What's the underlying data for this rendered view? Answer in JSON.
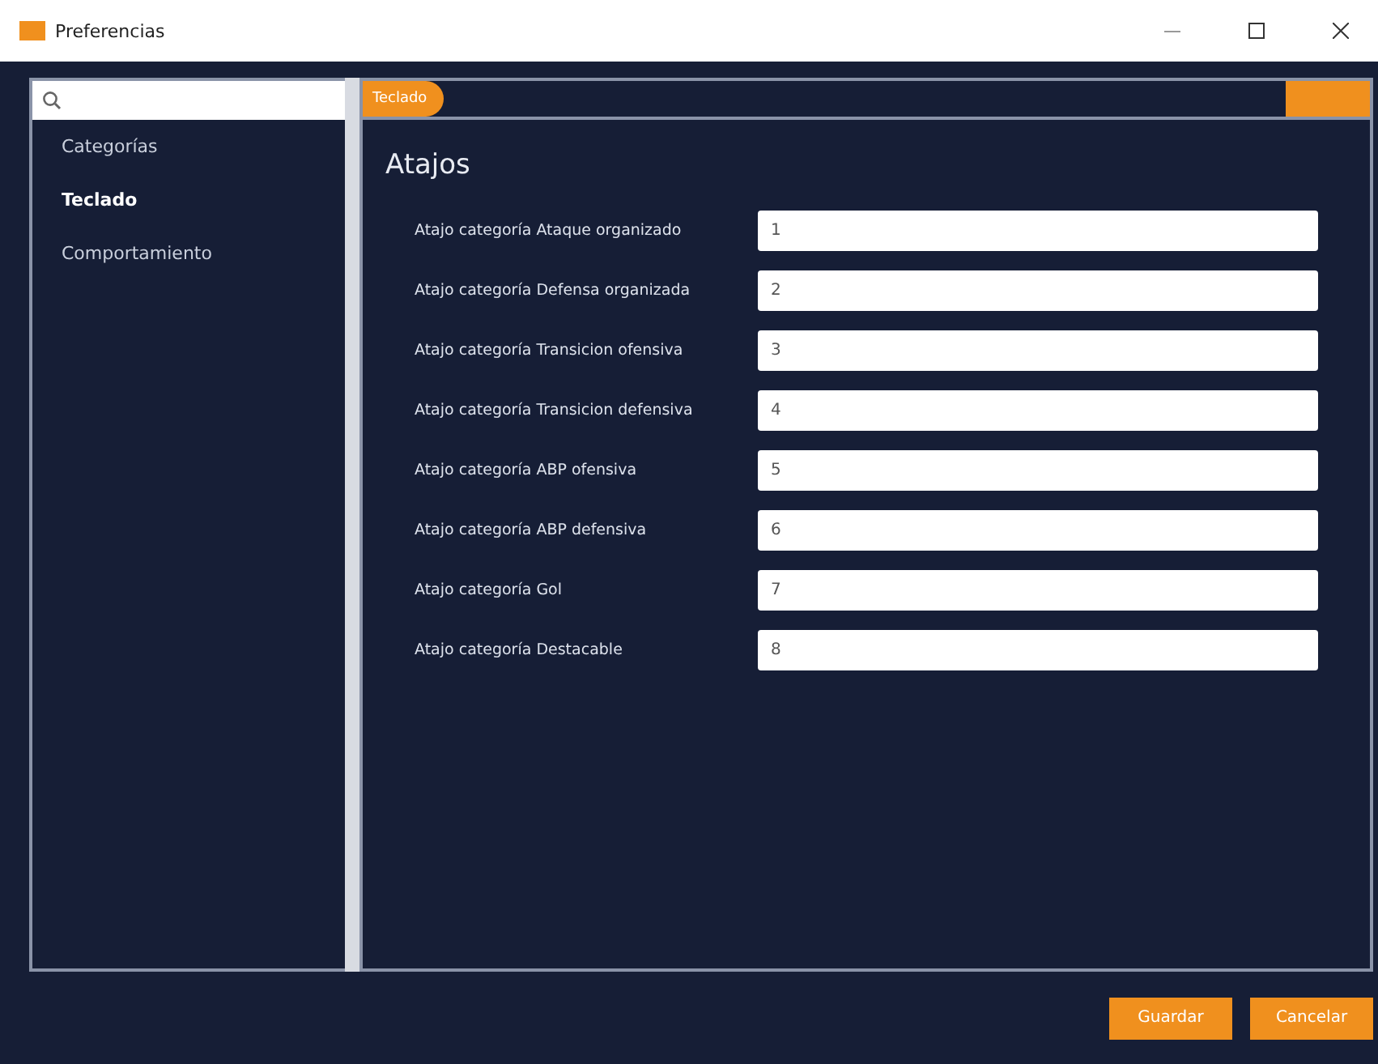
{
  "window": {
    "title": "Preferencias"
  },
  "sidebar": {
    "items": [
      {
        "label": "Categorías",
        "selected": false
      },
      {
        "label": "Teclado",
        "selected": true
      },
      {
        "label": "Comportamiento",
        "selected": false
      }
    ]
  },
  "tabs": [
    {
      "label": "Teclado",
      "selected": true
    }
  ],
  "section": {
    "title": "Atajos"
  },
  "shortcuts": [
    {
      "label": "Atajo categoría Ataque organizado",
      "value": "1"
    },
    {
      "label": "Atajo categoría Defensa organizada",
      "value": "2"
    },
    {
      "label": "Atajo categoría Transicion ofensiva",
      "value": "3"
    },
    {
      "label": "Atajo categoría Transicion defensiva",
      "value": "4"
    },
    {
      "label": "Atajo categoría ABP ofensiva",
      "value": "5"
    },
    {
      "label": "Atajo categoría ABP defensiva",
      "value": "6"
    },
    {
      "label": "Atajo categoría Gol",
      "value": "7"
    },
    {
      "label": "Atajo categoría Destacable",
      "value": "8"
    }
  ],
  "buttons": [
    "Guardar",
    "Cancelar"
  ]
}
